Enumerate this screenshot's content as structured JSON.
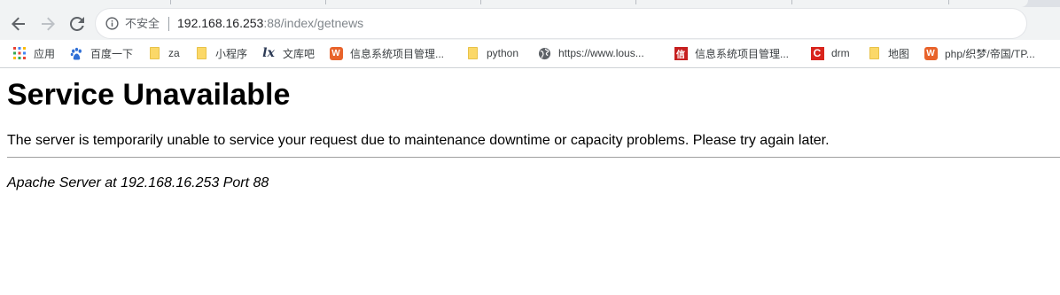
{
  "browser": {
    "security_label": "不安全",
    "url_host": "192.168.16.253",
    "url_path": ":88/index/getnews"
  },
  "bookmarks": [
    {
      "label": "应用",
      "icon": "apps-grid-icon"
    },
    {
      "label": "百度一下",
      "icon": "baidu-paw-icon"
    },
    {
      "label": "za",
      "icon": "folder-icon"
    },
    {
      "label": "小程序",
      "icon": "folder-icon"
    },
    {
      "label": "文库吧",
      "icon": "wenku-icon"
    },
    {
      "label": "信息系统项目管理...",
      "icon": "site-favicon-icon"
    },
    {
      "label": "python",
      "icon": "folder-icon"
    },
    {
      "label": "https://www.lous...",
      "icon": "globe-icon"
    },
    {
      "label": "信息系统项目管理...",
      "icon": "xin-favicon-icon"
    },
    {
      "label": "drm",
      "icon": "c-favicon-icon"
    },
    {
      "label": "地图",
      "icon": "folder-icon"
    },
    {
      "label": "php/织梦/帝国/TP...",
      "icon": "site-favicon-icon"
    }
  ],
  "page": {
    "heading": "Service Unavailable",
    "message": "The server is temporarily unable to service your request due to maintenance downtime or capacity problems. Please try again later.",
    "address": "Apache Server at 192.168.16.253 Port 88"
  },
  "colors": {
    "toolbar_bg": "#f1f3f4",
    "text_primary": "#202124",
    "text_secondary": "#5f6368",
    "folder": "#fbd868"
  }
}
